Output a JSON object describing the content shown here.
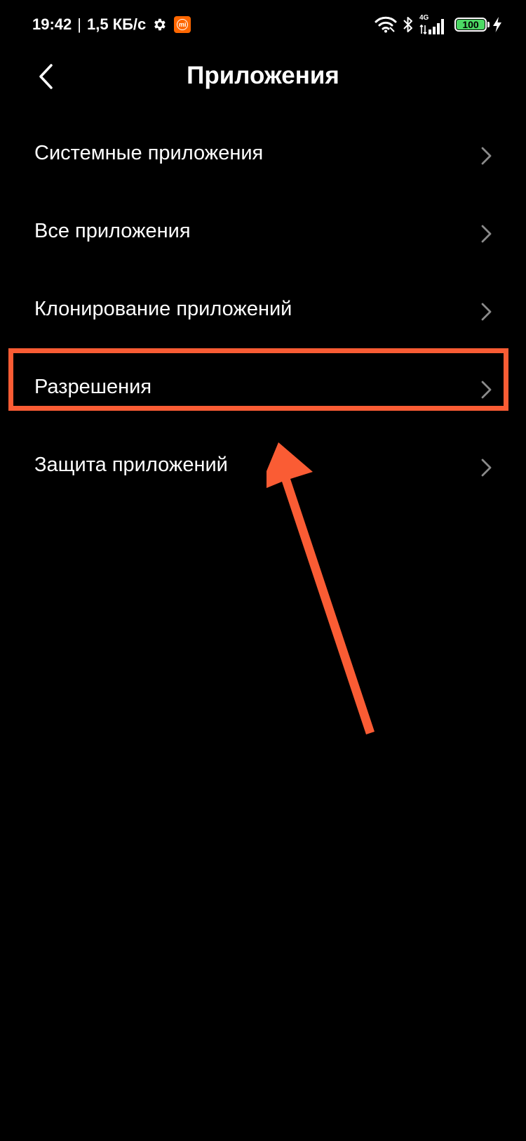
{
  "status_bar": {
    "time": "19:42",
    "separator": "|",
    "network_speed": "1,5 КБ/с",
    "network_type": "4G",
    "battery_level": "100",
    "battery_percent": 100
  },
  "header": {
    "title": "Приложения"
  },
  "menu": {
    "items": [
      {
        "label": "Системные приложения"
      },
      {
        "label": "Все приложения"
      },
      {
        "label": "Клонирование приложений"
      },
      {
        "label": "Разрешения"
      },
      {
        "label": "Защита приложений"
      }
    ]
  },
  "colors": {
    "background": "#000000",
    "text": "#ffffff",
    "chevron": "#8a8a8a",
    "annotation": "#fa5c34",
    "mi_orange": "#ff6700",
    "battery_green": "#4cd964"
  },
  "icons": {
    "back": "chevron-left-icon",
    "row": "chevron-right-icon",
    "settings": "gear-icon",
    "wifi": "wifi-icon",
    "bluetooth": "bluetooth-icon",
    "signal": "signal-icon",
    "charging": "lightning-icon"
  }
}
